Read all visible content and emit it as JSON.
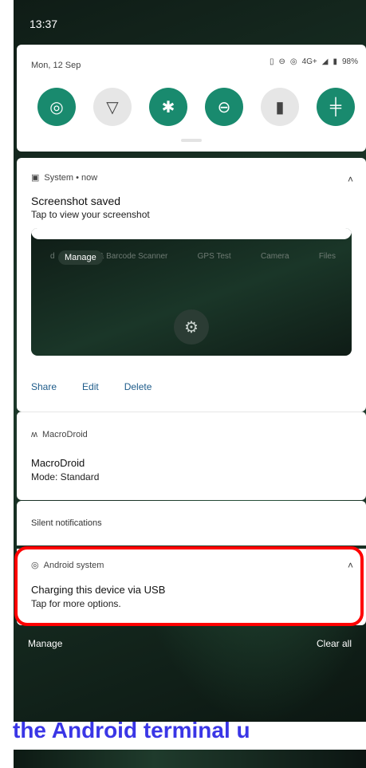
{
  "status": {
    "time": "13:37"
  },
  "quick_settings": {
    "date": "Mon, 12 Sep",
    "battery": "98%",
    "network": "4G+"
  },
  "tiles": [
    {
      "name": "hotspot-tile",
      "glyph": "◎",
      "state": "on"
    },
    {
      "name": "wifi-tile",
      "glyph": "▽",
      "state": "off"
    },
    {
      "name": "bluetooth-tile",
      "glyph": "✱",
      "state": "on"
    },
    {
      "name": "do-not-disturb-tile",
      "glyph": "⊖",
      "state": "on"
    },
    {
      "name": "flashlight-tile",
      "glyph": "▮",
      "state": "off"
    },
    {
      "name": "settings-tile",
      "glyph": "╪",
      "state": "on"
    }
  ],
  "notifications": {
    "screenshot": {
      "app": "System • now",
      "title": "Screenshot saved",
      "text": "Tap to view your screenshot",
      "preview_labels": [
        "d",
        "QR & Barcode Scanner",
        "GPS Test",
        "Camera",
        "Files"
      ],
      "preview_manage": "Manage",
      "actions": [
        "Share",
        "Edit",
        "Delete"
      ]
    },
    "macrodroid": {
      "app": "MacroDroid",
      "title": "MacroDroid",
      "text": "Mode: Standard"
    },
    "silent_label": "Silent notifications",
    "android_system": {
      "app": "Android system",
      "title": "Charging this device via USB",
      "text": "Tap for more options."
    }
  },
  "bottom": {
    "manage": "Manage",
    "clear_all": "Clear all"
  },
  "caption": "the Android terminal u",
  "colors": {
    "accent": "#198a6e",
    "highlight": "#ff0000",
    "caption": "#3a36e6"
  }
}
